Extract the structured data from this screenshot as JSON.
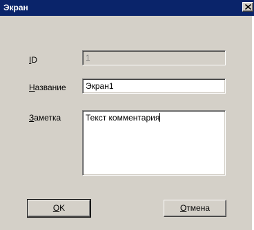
{
  "window": {
    "title": "Экран",
    "close_glyph": "×"
  },
  "fields": {
    "id": {
      "label_mnemonic": "I",
      "label_rest": "D",
      "value": "1"
    },
    "name": {
      "label_mnemonic": "Н",
      "label_rest": "азвание",
      "value": "Экран1"
    },
    "note": {
      "label_mnemonic": "З",
      "label_rest": "аметка",
      "value": "Текст комментария"
    }
  },
  "buttons": {
    "ok": {
      "mnemonic": "O",
      "rest": "K"
    },
    "cancel": {
      "mnemonic": "О",
      "rest": "тмена"
    }
  },
  "colors": {
    "titlebar": "#0a246a",
    "dialog_bg": "#d4d0c8"
  }
}
